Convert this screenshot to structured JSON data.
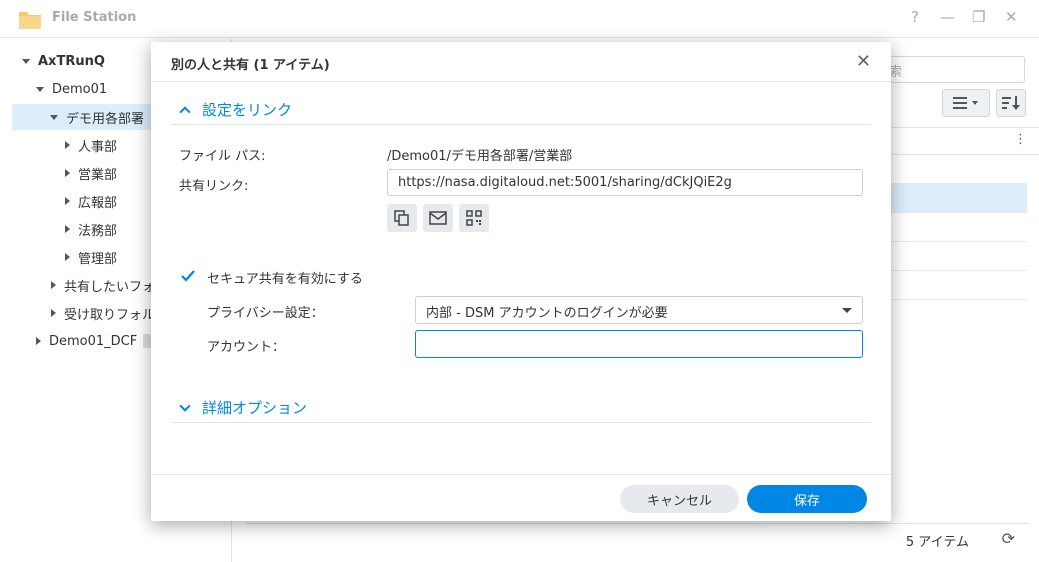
{
  "app": {
    "title": "File Station",
    "help_symbol": "?",
    "minimize_symbol": "—",
    "maximize_symbol": "❐",
    "close_symbol": "✕"
  },
  "sidebar": {
    "root": "AxTRunQ",
    "items": [
      {
        "label": "Demo01"
      },
      {
        "label": "デモ用各部署"
      },
      {
        "label": "人事部"
      },
      {
        "label": "営業部"
      },
      {
        "label": "広報部"
      },
      {
        "label": "法務部"
      },
      {
        "label": "管理部"
      },
      {
        "label": "共有したいフォ"
      },
      {
        "label": "受け取りフォル"
      },
      {
        "label": "Demo01_DCF"
      }
    ]
  },
  "main": {
    "search_placeholder": "索",
    "status_count": "5 アイテム"
  },
  "dialog": {
    "title": "別の人と共有 (1 アイテム)",
    "close_symbol": "✕",
    "section_link": "設定をリンク",
    "file_path_label": "ファイル パス:",
    "file_path_value": "/Demo01/デモ用各部署/営業部",
    "share_link_label": "共有リンク:",
    "share_link_value": "https://nasa.digitaloud.net:5001/sharing/dCkJQiE2g",
    "secure_share_label": "セキュア共有を有効にする",
    "secure_share_checked": true,
    "privacy_label": "プライバシー設定：",
    "privacy_value": "内部 - DSM アカウントのログインが必要",
    "account_label": "アカウント：",
    "account_value": "",
    "section_advanced": "詳細オプション",
    "cancel_label": "キャンセル",
    "save_label": "保存"
  },
  "colors": {
    "accent": "#0086e5",
    "selected_row": "#dceefc"
  },
  "icons": [
    "folder-icon",
    "copy-icon",
    "mail-icon",
    "qr-code-icon",
    "list-view-icon",
    "sort-icon",
    "refresh-icon",
    "more-icon"
  ]
}
